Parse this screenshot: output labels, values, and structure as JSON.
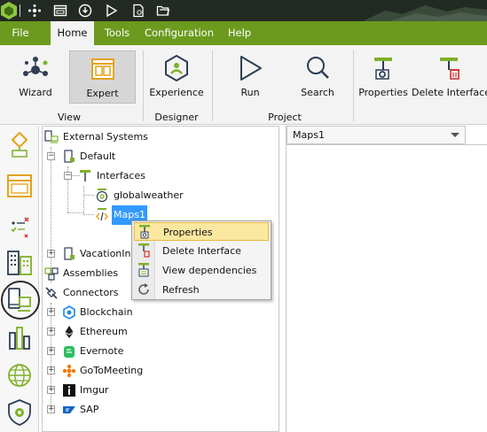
{
  "menubar": {
    "tabs": [
      {
        "label": "File",
        "active": false
      },
      {
        "label": "Home",
        "active": true
      },
      {
        "label": "Tools",
        "active": false
      },
      {
        "label": "Configuration",
        "active": false
      },
      {
        "label": "Help",
        "active": false
      }
    ]
  },
  "ribbon": {
    "buttons": {
      "wizard": "Wizard",
      "expert": "Expert",
      "experience": "Experience",
      "run": "Run",
      "search": "Search",
      "properties": "Properties",
      "delete_interface": "Delete Interface"
    },
    "groups": {
      "view": "View",
      "designer": "Designer",
      "project": "Project"
    }
  },
  "tree": {
    "items": [
      {
        "label": "External Systems"
      },
      {
        "label": "Default"
      },
      {
        "label": "Interfaces"
      },
      {
        "label": "globalweather"
      },
      {
        "label": "Maps1",
        "selected": true
      },
      {
        "label": "VacationInte"
      },
      {
        "label": "Assemblies"
      },
      {
        "label": "Connectors"
      },
      {
        "label": "Blockchain"
      },
      {
        "label": "Ethereum"
      },
      {
        "label": "Evernote"
      },
      {
        "label": "GoToMeeting"
      },
      {
        "label": "Imgur"
      },
      {
        "label": "SAP"
      }
    ]
  },
  "context_menu": {
    "items": [
      {
        "label": "Properties",
        "highlighted": true
      },
      {
        "label": "Delete Interface"
      },
      {
        "label": "View dependencies"
      },
      {
        "label": "Refresh"
      }
    ]
  },
  "document": {
    "tab_label": "Maps1"
  },
  "colors": {
    "menubar": "#6b9a1e",
    "titlebar": "#232a23",
    "accent_green": "#7fb02a",
    "selection": "#3399ff",
    "menu_highlight": "#fbe8a0"
  }
}
